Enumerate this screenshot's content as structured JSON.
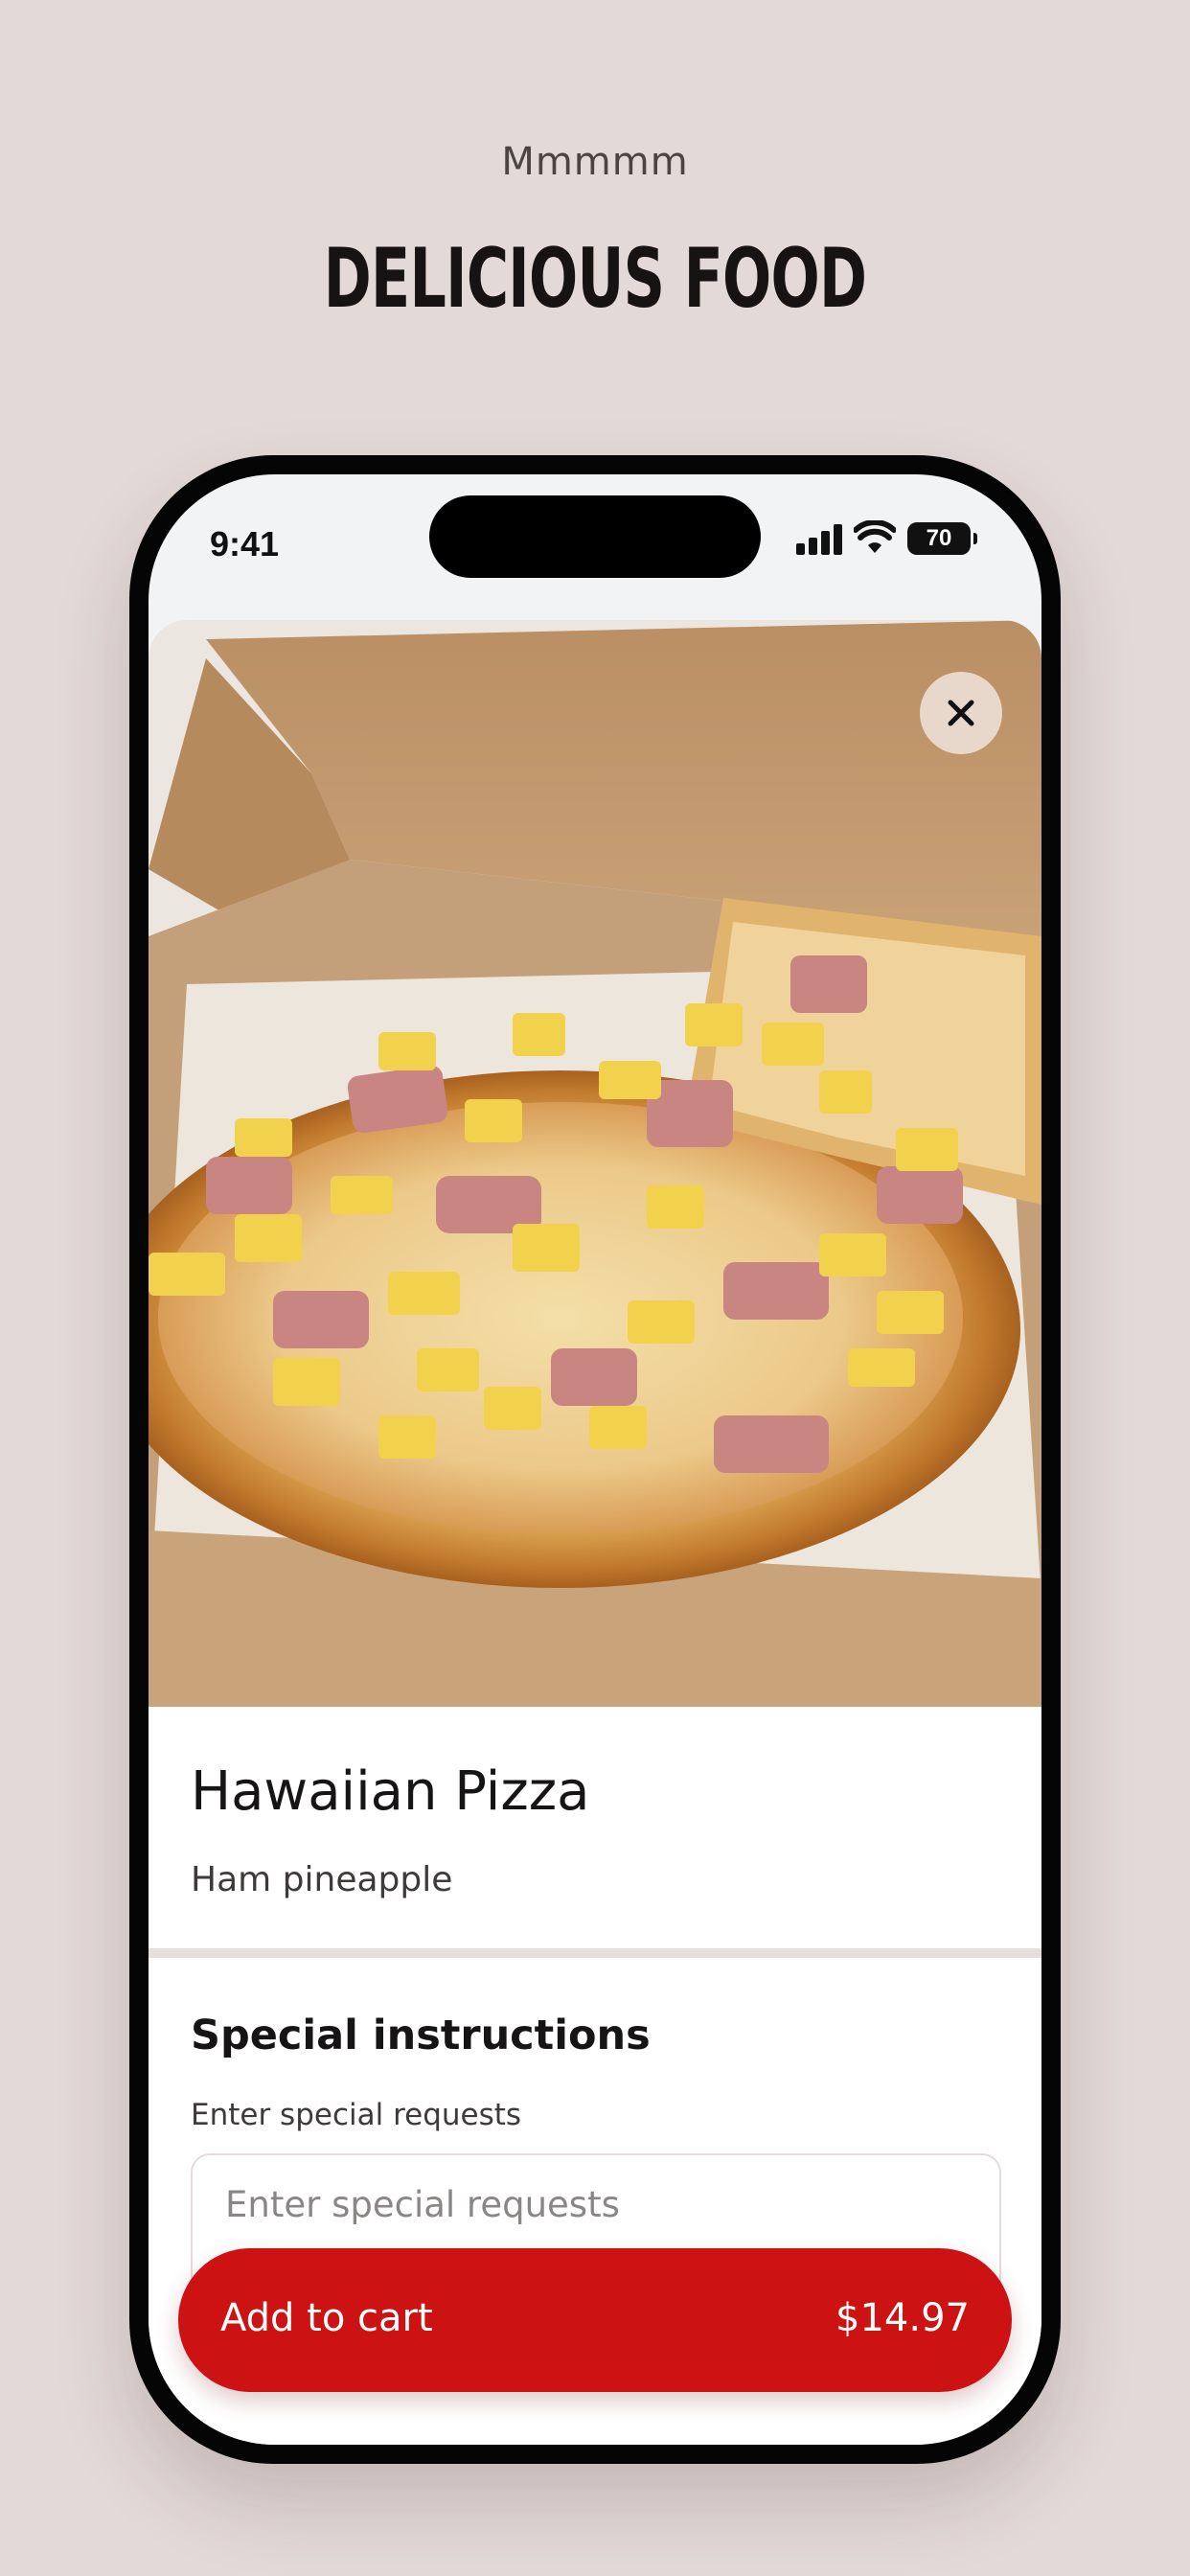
{
  "page": {
    "eyebrow": "Mmmmm",
    "headline": "DELICIOUS FOOD"
  },
  "status_bar": {
    "time": "9:41",
    "battery_level": "70",
    "icons": [
      "signal-icon",
      "wifi-icon",
      "battery-icon"
    ]
  },
  "product": {
    "image": "hawaiian-pizza-in-box",
    "name": "Hawaiian Pizza",
    "description": "Ham pineapple",
    "close_icon": "close-icon"
  },
  "special_instructions": {
    "title": "Special instructions",
    "subtitle": "Enter special requests",
    "placeholder": "Enter special requests",
    "value": ""
  },
  "cart": {
    "label": "Add to cart",
    "price": "$14.97"
  },
  "colors": {
    "background": "#e3d9d7",
    "accent": "#cc1212",
    "close_button": "#e8d8cc",
    "text": "#161414"
  }
}
